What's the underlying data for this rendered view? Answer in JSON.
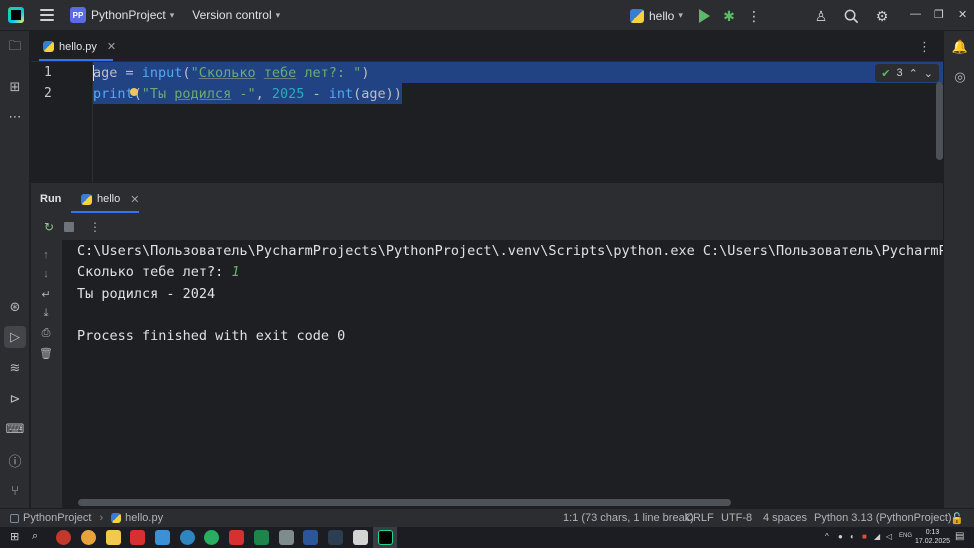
{
  "titlebar": {
    "project_badge": "PP",
    "project_name": "PythonProject",
    "version_control": "Version control",
    "run_config": "hello"
  },
  "editor": {
    "tab_label": "hello.py",
    "line_numbers": [
      "1",
      "2"
    ],
    "line1": {
      "var": "age",
      "eq": " = ",
      "fn": "input",
      "open": "(",
      "q1": "\"",
      "w1": "Сколько",
      "sp1": " ",
      "w2": "тебе",
      "sp2": " ",
      "w3": "лет?: \"",
      "close": ")"
    },
    "line2": {
      "fn": "print",
      "open": "(",
      "q1": "\"Ты ",
      "w1": "родился",
      "rest": " -\"",
      "comma": ", ",
      "num": "2025",
      "minus": " - ",
      "fn2": "int",
      "arg": "(age))"
    },
    "inspection_count": "3"
  },
  "run": {
    "title": "Run",
    "tab_label": "hello",
    "console_lines": [
      "C:\\Users\\Пользователь\\PycharmProjects\\PythonProject\\.venv\\Scripts\\python.exe C:\\Users\\Пользователь\\PycharmP",
      "Сколько тебе лет?: ",
      "Ты родился - 2024",
      "Process finished with exit code 0"
    ],
    "user_input": "1"
  },
  "statusbar": {
    "project": "PythonProject",
    "file": "hello.py",
    "position": "1:1 (73 chars, 1 line break)",
    "line_sep": "CRLF",
    "encoding": "UTF-8",
    "indent": "4 spaces",
    "interpreter": "Python 3.13 (PythonProject)"
  },
  "taskbar": {
    "lang": "ENG",
    "time": "0:13",
    "date": "17.02.2025"
  },
  "colors": {
    "accent": "#3574f0",
    "run_green": "#5fb865",
    "selection": "#214283"
  }
}
